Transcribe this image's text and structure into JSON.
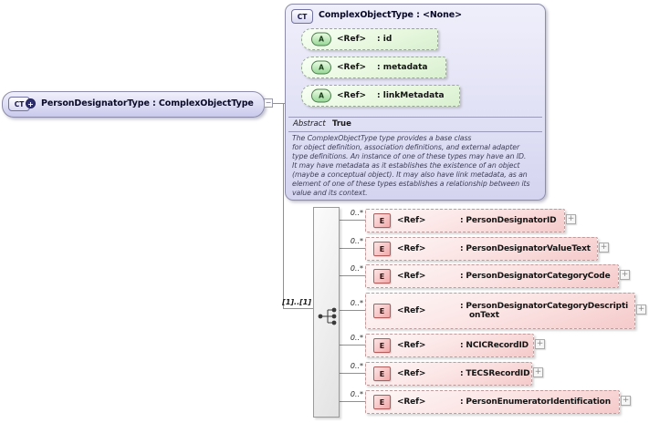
{
  "root": {
    "badge": "CT",
    "title": "PersonDesignatorType : ComplexObjectType"
  },
  "base": {
    "badge": "CT",
    "title": "ComplexObjectType : <None>",
    "attributes": [
      {
        "badge": "A",
        "ref": "<Ref>",
        "name": ": id"
      },
      {
        "badge": "A",
        "ref": "<Ref>",
        "name": ": metadata"
      },
      {
        "badge": "A",
        "ref": "<Ref>",
        "name": ": linkMetadata"
      }
    ],
    "abstract_label": "Abstract",
    "abstract_value": "True",
    "description_lines": [
      "The ComplexObjectType type provides a base class",
      "for object definition, association definitions, and external adapter",
      "type definitions. An instance of one of these types may have an ID.",
      "It may have metadata as it establishes the existence of an object",
      "(maybe a conceptual object). It may also have link metadata, as an",
      "element of one of these types establishes a relationship between its",
      "value and its context."
    ]
  },
  "sequence": {
    "cardinality": "[1]..[1]"
  },
  "elements": [
    {
      "occurs": "0..*",
      "badge": "E",
      "ref": "<Ref>",
      "name": ": PersonDesignatorID",
      "name2": ""
    },
    {
      "occurs": "0..*",
      "badge": "E",
      "ref": "<Ref>",
      "name": ": PersonDesignatorValueText",
      "name2": ""
    },
    {
      "occurs": "0..*",
      "badge": "E",
      "ref": "<Ref>",
      "name": ": PersonDesignatorCategoryCode",
      "name2": ""
    },
    {
      "occurs": "0..*",
      "badge": "E",
      "ref": "<Ref>",
      "name": ": PersonDesignatorCategoryDescripti",
      "name2": "onText"
    },
    {
      "occurs": "0..*",
      "badge": "E",
      "ref": "<Ref>",
      "name": ": NCICRecordID",
      "name2": ""
    },
    {
      "occurs": "0..*",
      "badge": "E",
      "ref": "<Ref>",
      "name": ": TECSRecordID",
      "name2": ""
    },
    {
      "occurs": "0..*",
      "badge": "E",
      "ref": "<Ref>",
      "name": ": PersonEnumeratorIdentification",
      "name2": ""
    }
  ],
  "icons": {
    "expand": "+",
    "collapse": "−",
    "complex_type_badge": "CT",
    "attribute_badge": "A",
    "element_badge": "E"
  },
  "colors": {
    "type_box_fill": "#dcdcf4",
    "attribute_fill": "#e8f8df",
    "element_fill": "#fbe2e2",
    "attribute_badge": "#98d898",
    "element_badge": "#f2a9a9",
    "connector": "#909090"
  }
}
